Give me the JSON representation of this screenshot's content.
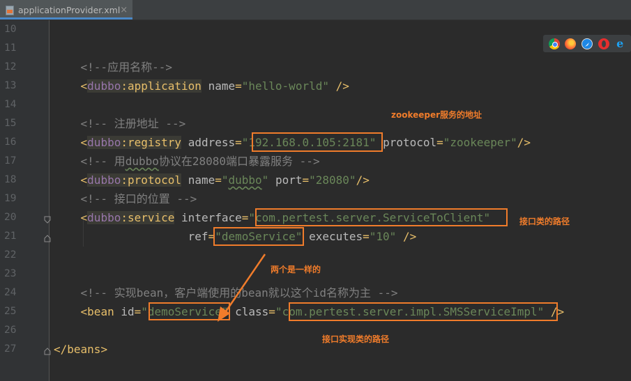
{
  "tab": {
    "filename": "applicationProvider.xml",
    "close": "×",
    "icon": "xml-file-icon"
  },
  "lines": [
    {
      "n": "10",
      "parts": []
    },
    {
      "n": "11",
      "parts": []
    },
    {
      "n": "12",
      "parts": [
        [
          "c",
          "    <!--应用名称-->"
        ]
      ]
    },
    {
      "n": "13",
      "parts": [
        [
          "t",
          "    <"
        ],
        [
          "nsh",
          "dubbo"
        ],
        [
          "th",
          ":application"
        ],
        [
          "t",
          " "
        ],
        [
          "a",
          "name"
        ],
        [
          "t",
          "="
        ],
        [
          "v",
          "\"hello-world\""
        ],
        [
          "t",
          " />"
        ]
      ]
    },
    {
      "n": "14",
      "parts": []
    },
    {
      "n": "15",
      "parts": [
        [
          "c",
          "    <!-- 注册地址 -->"
        ]
      ]
    },
    {
      "n": "16",
      "parts": [
        [
          "t",
          "    <"
        ],
        [
          "nsh",
          "dubbo"
        ],
        [
          "th",
          ":registry"
        ],
        [
          "t",
          " "
        ],
        [
          "a",
          "address"
        ],
        [
          "t",
          "="
        ],
        [
          "v",
          "\"192.168.0.105:2181\""
        ],
        [
          "t",
          " "
        ],
        [
          "a",
          "protocol"
        ],
        [
          "t",
          "="
        ],
        [
          "v",
          "\"zookeeper\""
        ],
        [
          "t",
          "/>"
        ]
      ]
    },
    {
      "n": "17",
      "parts": [
        [
          "c",
          "    <!-- 用"
        ],
        [
          "cu",
          "dubbo"
        ],
        [
          "c",
          "协议在28080端口暴露服务 -->"
        ]
      ]
    },
    {
      "n": "18",
      "parts": [
        [
          "t",
          "    <"
        ],
        [
          "nsh",
          "dubbo"
        ],
        [
          "th",
          ":protocol"
        ],
        [
          "t",
          " "
        ],
        [
          "a",
          "name"
        ],
        [
          "t",
          "="
        ],
        [
          "v",
          "\""
        ],
        [
          "vu",
          "dubbo"
        ],
        [
          "v",
          "\""
        ],
        [
          "t",
          " "
        ],
        [
          "a",
          "port"
        ],
        [
          "t",
          "="
        ],
        [
          "v",
          "\"28080\""
        ],
        [
          "t",
          "/>"
        ]
      ]
    },
    {
      "n": "19",
      "parts": [
        [
          "c",
          "    <!-- 接口的位置 -->"
        ]
      ]
    },
    {
      "n": "20",
      "parts": [
        [
          "t",
          "    <"
        ],
        [
          "nsh",
          "dubbo"
        ],
        [
          "th",
          ":service"
        ],
        [
          "t",
          " "
        ],
        [
          "a",
          "interface"
        ],
        [
          "t",
          "="
        ],
        [
          "v",
          "\"com.pertest.server.ServiceToClient\""
        ]
      ]
    },
    {
      "n": "21",
      "parts": [
        [
          "t",
          "                    "
        ],
        [
          "a",
          "ref"
        ],
        [
          "t",
          "="
        ],
        [
          "v",
          "\"demoService\""
        ],
        [
          "t",
          " "
        ],
        [
          "a",
          "executes"
        ],
        [
          "t",
          "="
        ],
        [
          "v",
          "\"10\""
        ],
        [
          "t",
          " />"
        ]
      ]
    },
    {
      "n": "22",
      "parts": []
    },
    {
      "n": "23",
      "parts": []
    },
    {
      "n": "24",
      "parts": [
        [
          "c",
          "    <!-- 实现bean，客户端使用的bean就以这个id名称为主 -->"
        ]
      ]
    },
    {
      "n": "25",
      "parts": [
        [
          "t",
          "    <"
        ],
        [
          "tg",
          "bean"
        ],
        [
          "t",
          " "
        ],
        [
          "a",
          "id"
        ],
        [
          "t",
          "="
        ],
        [
          "v",
          "\"demoService\""
        ],
        [
          "t",
          " "
        ],
        [
          "a",
          "class"
        ],
        [
          "t",
          "="
        ],
        [
          "v",
          "\"com.pertest.server.impl.SMSServiceImpl\""
        ],
        [
          "t",
          " />"
        ]
      ]
    },
    {
      "n": "26",
      "parts": []
    },
    {
      "n": "27",
      "parts": [
        [
          "t",
          "</"
        ],
        [
          "tg",
          "beans"
        ],
        [
          "t",
          ">"
        ]
      ]
    }
  ],
  "annotations": {
    "zookeeper": "zookeeper服务的地址",
    "interface": "接口类的路径",
    "same": "两个是一样的",
    "impl": "接口实现类的路径"
  },
  "browsers": [
    "chrome-icon",
    "firefox-icon",
    "safari-icon",
    "opera-icon",
    "ie-icon"
  ],
  "colors": {
    "highlight": "#f07c2b",
    "comment": "#808080",
    "tag": "#e8bf6a",
    "namespace": "#9876aa",
    "value": "#6a8759"
  }
}
